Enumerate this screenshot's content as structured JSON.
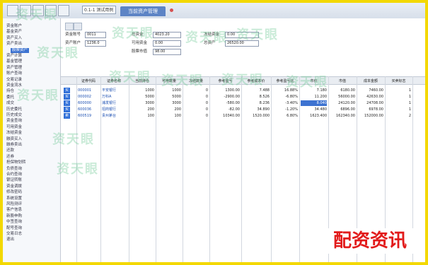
{
  "toolbar": {
    "dropdown_value": "0.1-1 测试用例",
    "active_tab_label": "当前资产管理",
    "buttons": [
      "new-icon",
      "save-icon",
      "print-icon",
      "open-icon",
      "refresh-icon"
    ]
  },
  "sidebar": {
    "items": [
      {
        "label": "资金账户",
        "active": false
      },
      {
        "label": "基金资产",
        "active": false
      },
      {
        "label": "资产买入",
        "active": false
      },
      {
        "label": "资产卖出",
        "active": false
      },
      {
        "label": "股票资产",
        "active": true
      },
      {
        "label": "资产计算",
        "active": false
      },
      {
        "label": "基金管理",
        "active": false
      },
      {
        "label": "资产管理",
        "active": false
      },
      {
        "label": "账户查询",
        "active": false
      },
      {
        "label": "交易记录",
        "active": false
      },
      {
        "label": "资金流水",
        "active": false
      },
      {
        "label": "持仓",
        "active": false
      },
      {
        "label": "委托",
        "active": false
      },
      {
        "label": "成交",
        "active": false
      },
      {
        "label": "历史委托",
        "active": false
      },
      {
        "label": "历史成交",
        "active": false
      },
      {
        "label": "资金查询",
        "active": false
      },
      {
        "label": "可用资金",
        "active": false
      },
      {
        "label": "冻结资金",
        "active": false
      },
      {
        "label": "融资买入",
        "active": false
      },
      {
        "label": "融券卖出",
        "active": false
      },
      {
        "label": "还款",
        "active": false
      },
      {
        "label": "还券",
        "active": false
      },
      {
        "label": "担保物划转",
        "active": false
      },
      {
        "label": "负债查询",
        "active": false
      },
      {
        "label": "合约查询",
        "active": false
      },
      {
        "label": "银证转账",
        "active": false
      },
      {
        "label": "资金调拨",
        "active": false
      },
      {
        "label": "修改密码",
        "active": false
      },
      {
        "label": "系统设置",
        "active": false
      },
      {
        "label": "风险测评",
        "active": false
      },
      {
        "label": "客户信息",
        "active": false
      },
      {
        "label": "新股申购",
        "active": false
      },
      {
        "label": "中签查询",
        "active": false
      },
      {
        "label": "配号查询",
        "active": false
      },
      {
        "label": "交易日志",
        "active": false
      },
      {
        "label": "退出",
        "active": false
      }
    ]
  },
  "filters": {
    "labels": [
      "资金账号",
      "资产账户",
      "总资金",
      "可用资金",
      "股票市值",
      "冻结资金",
      "总资产"
    ],
    "values": [
      "0011",
      "1236.0",
      "4023.20",
      "0.00",
      "98.00",
      "0.00",
      "26520.00"
    ]
  },
  "table": {
    "columns": [
      "证券代码",
      "证券名称",
      "当前持仓",
      "可用数量",
      "冻结数量",
      "参考盈亏",
      "参考成本价",
      "参考盈亏比",
      "市价",
      "市值",
      "成本金额",
      "买卖标志"
    ],
    "rows": [
      {
        "flag": "买",
        "cells": [
          "000001",
          "平安银行",
          "1000",
          "1000",
          "0",
          "1300.00",
          "7.488",
          "16.88%",
          "7.180",
          "6180.00",
          "7460.00",
          "1"
        ]
      },
      {
        "flag": "买",
        "cells": [
          "000002",
          "万科A",
          "5000",
          "5000",
          "0",
          "-2900.00",
          "8.526",
          "-6.80%",
          "11.200",
          "56000.00",
          "42630.00",
          "1"
        ]
      },
      {
        "flag": "买",
        "cells": [
          "600000",
          "浦发银行",
          "3000",
          "3000",
          "0",
          "-580.00",
          "8.236",
          "-3.40%",
          "8.040",
          "24120.00",
          "24708.00",
          "1"
        ]
      },
      {
        "flag": "买",
        "cells": [
          "600036",
          "招商银行",
          "200",
          "200",
          "0",
          "-82.00",
          "34.890",
          "-1.20%",
          "34.480",
          "6896.00",
          "6978.00",
          "1"
        ]
      },
      {
        "flag": "卖",
        "cells": [
          "600519",
          "贵州茅台",
          "100",
          "100",
          "0",
          "10340.00",
          "1520.000",
          "6.80%",
          "1623.400",
          "162340.00",
          "152000.00",
          "2"
        ]
      }
    ]
  },
  "watermark": {
    "text": "资天眼",
    "repeat": 12
  },
  "brand": {
    "text": "配资资讯"
  }
}
